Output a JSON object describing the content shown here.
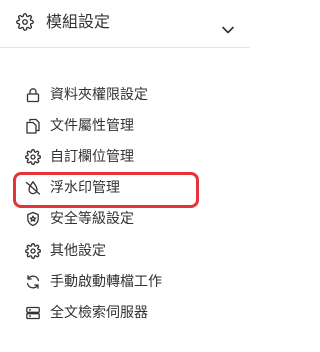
{
  "header": {
    "title": "模組設定",
    "icon": "gear-icon",
    "toggle_icon": "chevron-down-icon"
  },
  "menu": {
    "items": [
      {
        "label": "資料夾權限設定",
        "icon": "lock-icon"
      },
      {
        "label": "文件屬性管理",
        "icon": "copy-document-icon"
      },
      {
        "label": "自訂欄位管理",
        "icon": "gear-icon"
      },
      {
        "label": "浮水印管理",
        "icon": "watermark-icon"
      },
      {
        "label": "安全等級設定",
        "icon": "shield-icon"
      },
      {
        "label": "其他設定",
        "icon": "gear-icon"
      },
      {
        "label": "手動啟動轉檔工作",
        "icon": "sync-icon"
      },
      {
        "label": "全文檢索伺服器",
        "icon": "server-icon"
      }
    ],
    "highlighted_item": "浮水印管理"
  },
  "colors": {
    "highlight": "#e5333a",
    "text": "#333333",
    "divider": "#e5e5e5"
  }
}
